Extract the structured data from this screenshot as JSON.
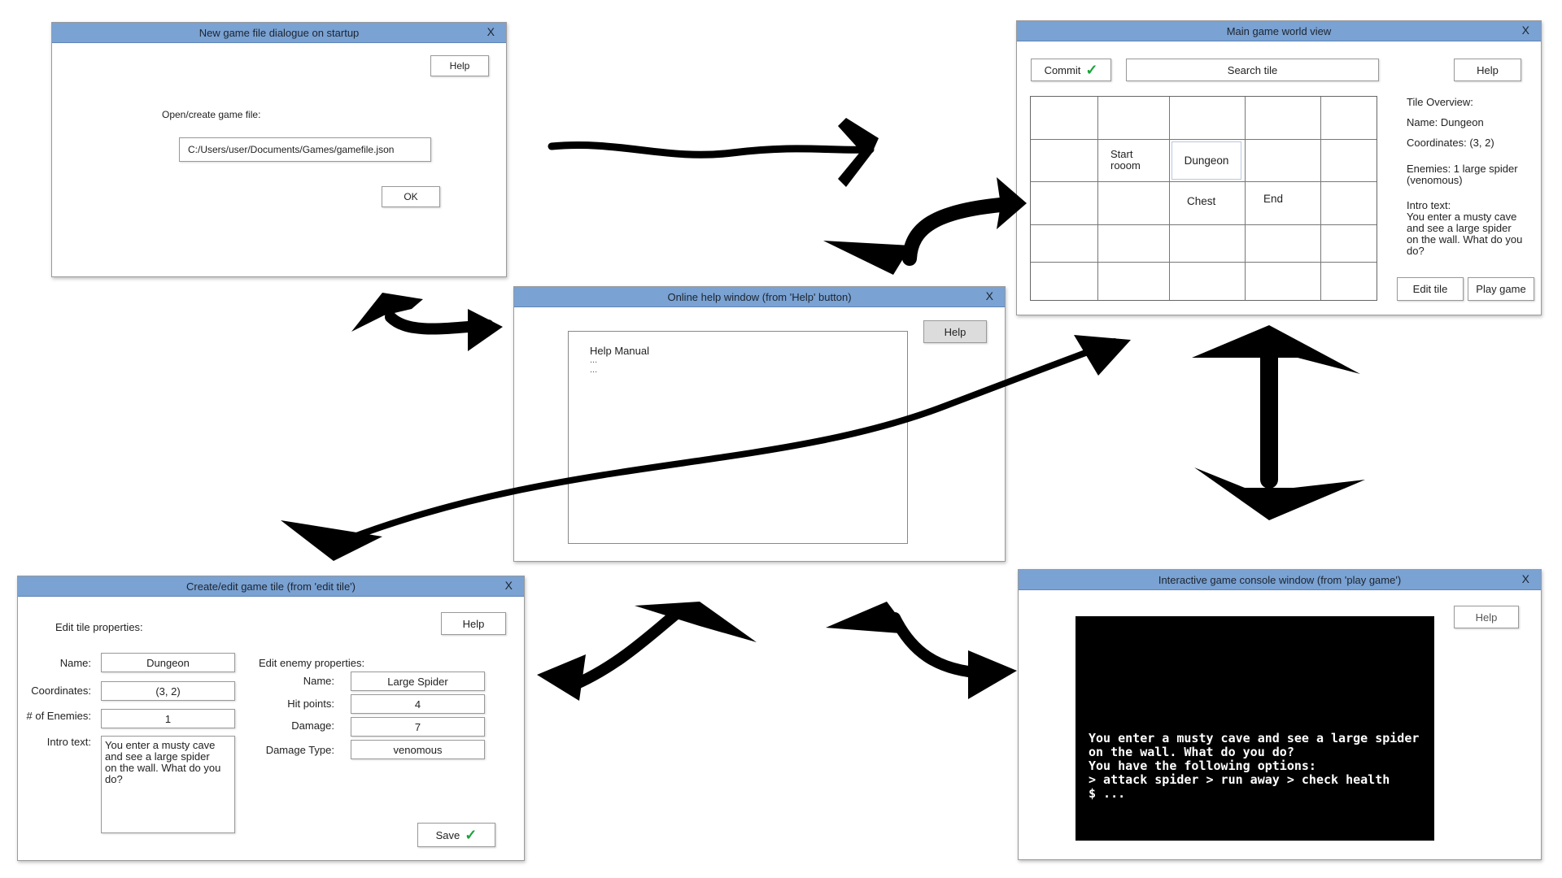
{
  "close_symbol": "X",
  "newgame": {
    "title": "New game file dialogue on startup",
    "help": "Help",
    "prompt": "Open/create game file:",
    "path_value": "C:/Users/user/Documents/Games/gamefile.json",
    "ok": "OK"
  },
  "help_window": {
    "title": "Online help window (from 'Help' button)",
    "help": "Help",
    "lines": [
      "Help Manual",
      "...",
      "..."
    ]
  },
  "main": {
    "title": "Main game world view",
    "commit": "Commit",
    "search": "Search tile",
    "help": "Help",
    "cells": {
      "start_line1": "Start",
      "start_line2": "rooom",
      "dungeon": "Dungeon",
      "chest": "Chest",
      "end": "End"
    },
    "overview": {
      "heading": "Tile Overview:",
      "name": "Name:  Dungeon",
      "coords": "Coordinates: (3, 2)",
      "enemies_1": "Enemies: 1 large spider",
      "enemies_2": "(venomous)",
      "intro_label": "Intro text:",
      "intro_1": "You enter a musty cave",
      "intro_2": "and see a large spider",
      "intro_3": "on the wall. What do you",
      "intro_4": "do?"
    },
    "edit_tile": "Edit tile",
    "play_game": "Play game"
  },
  "edit": {
    "title": "Create/edit game tile (from 'edit tile')",
    "heading": "Edit tile properties:",
    "help": "Help",
    "name_label": "Name:",
    "name_value": "Dungeon",
    "coords_label": "Coordinates:",
    "coords_value": "(3, 2)",
    "enemies_label": "# of Enemies:",
    "enemies_value": "1",
    "intro_label": "Intro text:",
    "intro_1": "You enter a musty cave",
    "intro_2": "and see a large spider",
    "intro_3": "on the wall. What do you",
    "intro_4": "do?",
    "enemy_heading": "Edit enemy properties:",
    "e_name_label": "Name:",
    "e_name_value": "Large Spider",
    "hp_label": "Hit points:",
    "hp_value": "4",
    "dmg_label": "Damage:",
    "dmg_value": "7",
    "dtype_label": "Damage Type:",
    "dtype_value": "venomous",
    "save": "Save"
  },
  "console_window": {
    "title": "Interactive game console window (from 'play game')",
    "help": "Help",
    "lines": [
      "You enter a musty cave and see a large spider",
      "on the wall. What do you do?",
      "You have the following options:",
      "> attack spider > run away > check health",
      "",
      "$ ..."
    ]
  },
  "colors": {
    "titlebar": "#7aa2d2",
    "check": "#1aa33a",
    "console_bg": "#000000"
  }
}
